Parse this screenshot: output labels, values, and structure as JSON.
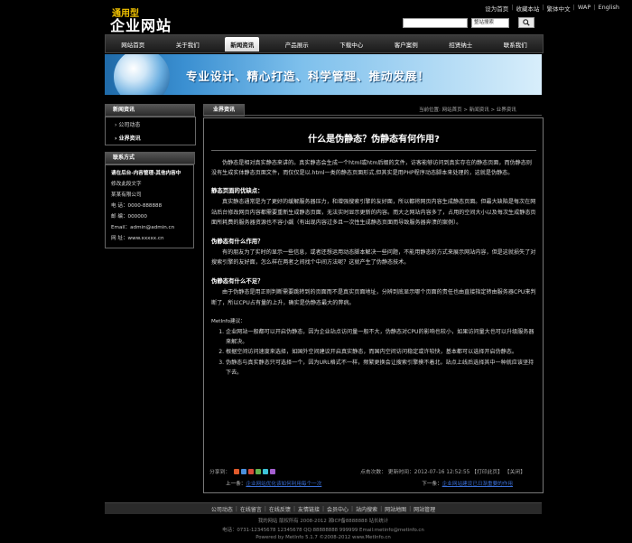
{
  "header": {
    "logo_small": "通用型",
    "logo_big": "企业网站",
    "top_links": [
      "设为首页",
      "收藏本站",
      "繁体中文",
      "WAP",
      "English"
    ],
    "search_placeholder": "",
    "search_select": "整站搜索"
  },
  "nav": [
    "网站首页",
    "关于我们",
    "新闻资讯",
    "产品展示",
    "下载中心",
    "客户案例",
    "招贤纳士",
    "联系我们"
  ],
  "banner": {
    "text": "专业设计、精心打造、科学管理、推动发展！"
  },
  "sidebar": {
    "news_title": "新闻资讯",
    "news_items": [
      "公司动态",
      "业界资讯"
    ],
    "contact_title": "联系方式",
    "contact_lines": [
      "请在后台-内容管理-其他内容中",
      "修改此段文字",
      "某某有限公司",
      "电 话：0000-888888",
      "邮 编：000000",
      "Email：admin@admin.cn",
      "网 址：www.xxxxx.cn"
    ]
  },
  "main": {
    "tab_label": "业界资讯",
    "breadcrumb": "当前位置: 网站首页 > 新闻资讯 > 业界资讯",
    "title": "什么是伪静态？伪静态有何作用?",
    "intro": "伪静态是相对真实静态来讲的。真实静态会生成一个html或htm后缀的文件，访客能够访问到真实存在的静态页面，而伪静态则没有生成实体静态页面文件，而仅仅是以.html一类的静态页面形式,但其实是用PHP程序动态脚本来处理的，这就是伪静态。",
    "s1_head": "静态页面的优缺点：",
    "s1_body": "真实静态通常是为了更好的缓解服务器压力，和增强搜索引擎的友好面，所以都将网页内容生成静态页面。但最大缺陷是每次在网站后台修改网页内容都需要重新生成静态页面，无法实时显示更新的内容。而大之网站内容多了，占用的空间大小以及每次生成静态页面所耗费的服务器资源也不容小觑（有出现内容过多且一次性生成静态页面而导致服务器奔溃的案例）。",
    "s2_head": "伪静态有什么作用？",
    "s2_body": "有的朋友为了实时的显示一些信息，或者还想运用动态脚本解决一些问题，不能用静态的方式来展示网站内容，但是这就损失了对搜索引擎的友好面，怎么样在两者之间找个中间方法呢？这就产生了伪静态技术。",
    "s3_head": "伪静态有什么不足？",
    "s3_body": "由于伪静态是用正则判断需要跳转到的页面而不是真实页面地址，分辨到底显示哪个页面的责任也由直接指定转由服务器CPU来判断了，所以CPU占有量的上升，确实是伪静态最大的弊病。",
    "notes_head": "MetInfo建议：",
    "notes": [
      "企业网站一般都可以开启伪静态，因为企业站点访问量一般不大，伪静态对CPU的影响也较小，如果访问量大也可以升级服务器来解决。",
      "根据空间访问速度来选择，如国外空间建议开启真实静态，而国内空间访问稳定或许较快，基本都可以选择开启伪静态。",
      "伪静态与真实静态只可选择一个，因为URL格式不一样，频繁更换会让搜索引擎摸不着北，站点上线后选择其中一种就应该坚持下去。"
    ],
    "share_label": "分享到：",
    "meta": "点击次数：  更新时间：2012-07-16 12:52:55  【打印此页】  【关闭】",
    "prev_label": "上一条：",
    "prev_link": "企业网站优化该如何利用每个一次",
    "next_label": "下一条：",
    "next_link": "企业网站建设已日渐重要的作用",
    "share_colors": [
      "#e05a2b",
      "#4a8fdb",
      "#d94c3a",
      "#62b34f",
      "#3cc2d6",
      "#a45fcf"
    ]
  },
  "footer": {
    "links": [
      "公司动态",
      "在线留言",
      "在线反馈",
      "友情链接",
      "会员中心",
      "站内搜索",
      "网站地图",
      "网站管理"
    ],
    "line1": "我的网站 版权所有 2008-2012 湘ICP备8888888 站长统计",
    "line2": "电话：0731-12345678 12345678  QQ:88888888 999999 Email:metinfo@metinfo.cn",
    "line3": "Powered by MetInfo 5.1.7 ©2008-2012 www.MetInfo.cn"
  }
}
